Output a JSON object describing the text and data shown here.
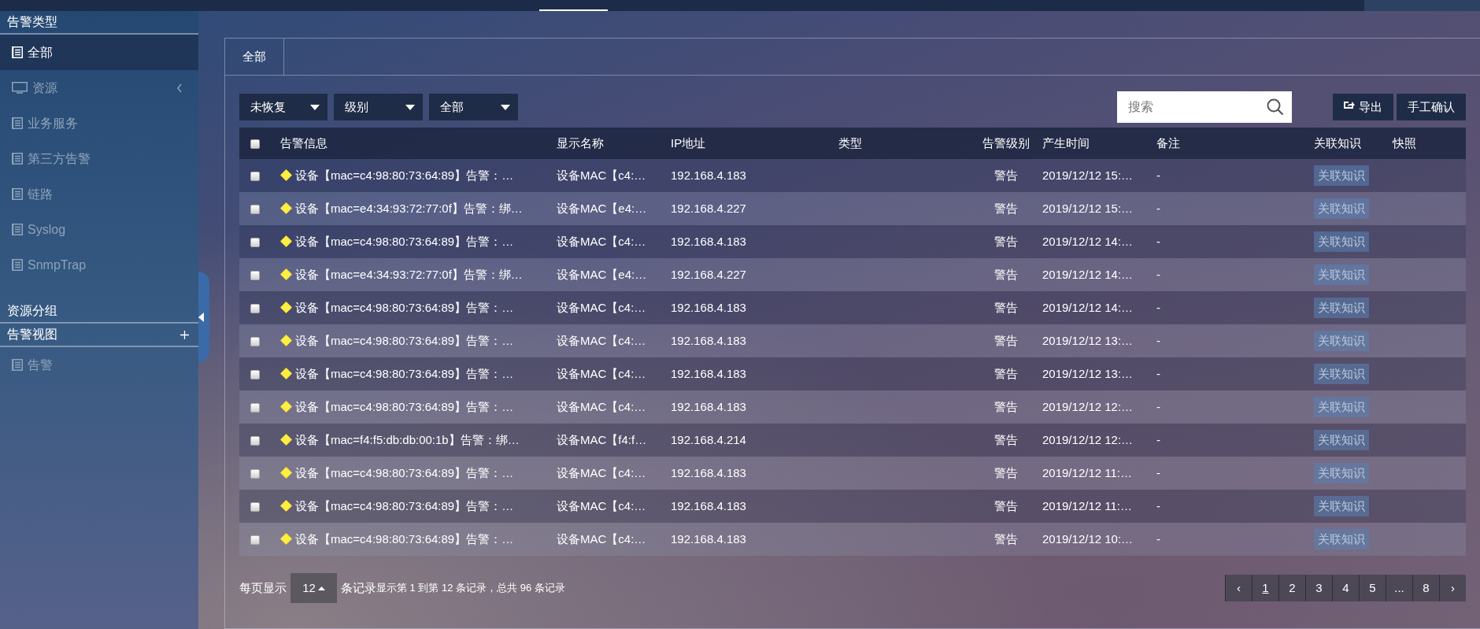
{
  "sidebar": {
    "sections": [
      {
        "title": "告警类型",
        "items": [
          {
            "label": "全部",
            "kind": "list",
            "selected": true
          },
          {
            "label": "资源",
            "kind": "monitor",
            "selected": false,
            "has_submenu": true
          },
          {
            "label": "业务服务",
            "kind": "list",
            "selected": false
          },
          {
            "label": "第三方告警",
            "kind": "list",
            "selected": false
          },
          {
            "label": "链路",
            "kind": "list",
            "selected": false
          },
          {
            "label": "Syslog",
            "kind": "list",
            "selected": false
          },
          {
            "label": "SnmpTrap",
            "kind": "list",
            "selected": false
          }
        ]
      },
      {
        "title": "资源分组"
      },
      {
        "title": "告警视图",
        "add_button": true,
        "items": [
          {
            "label": "告警",
            "kind": "list",
            "selected": false
          }
        ]
      }
    ]
  },
  "tabs": [
    {
      "label": "全部",
      "selected": true
    }
  ],
  "filters": [
    {
      "value": "未恢复"
    },
    {
      "value": "级别"
    },
    {
      "value": "全部"
    }
  ],
  "search": {
    "placeholder": "搜索"
  },
  "buttons": [
    {
      "label": "导出"
    },
    {
      "label": "手工确认"
    }
  ],
  "table": {
    "select_all": {
      "checked": false
    },
    "columns": [
      "告警信息",
      "显示名称",
      "IP地址",
      "类型",
      "告警级别",
      "产生时间",
      "备注",
      "关联知识",
      "快照"
    ],
    "rows": [
      {
        "checked": false,
        "info": "设备【mac=c4:98:80:73:64:89】告警：…",
        "name": "设备MAC【c4:…",
        "ip": "192.168.4.183",
        "level": "警告",
        "time": "2019/12/12 15:…",
        "note": "-",
        "knowledge": "关联知识"
      },
      {
        "checked": false,
        "info": "设备【mac=e4:34:93:72:77:0f】告警：绑…",
        "name": "设备MAC【e4:…",
        "ip": "192.168.4.227",
        "level": "警告",
        "time": "2019/12/12 15:…",
        "note": "-",
        "knowledge": "关联知识"
      },
      {
        "checked": false,
        "info": "设备【mac=c4:98:80:73:64:89】告警：…",
        "name": "设备MAC【c4:…",
        "ip": "192.168.4.183",
        "level": "警告",
        "time": "2019/12/12 14:…",
        "note": "-",
        "knowledge": "关联知识"
      },
      {
        "checked": false,
        "info": "设备【mac=e4:34:93:72:77:0f】告警：绑…",
        "name": "设备MAC【e4:…",
        "ip": "192.168.4.227",
        "level": "警告",
        "time": "2019/12/12 14:…",
        "note": "-",
        "knowledge": "关联知识"
      },
      {
        "checked": false,
        "info": "设备【mac=c4:98:80:73:64:89】告警：…",
        "name": "设备MAC【c4:…",
        "ip": "192.168.4.183",
        "level": "警告",
        "time": "2019/12/12 14:…",
        "note": "-",
        "knowledge": "关联知识"
      },
      {
        "checked": false,
        "info": "设备【mac=c4:98:80:73:64:89】告警：…",
        "name": "设备MAC【c4:…",
        "ip": "192.168.4.183",
        "level": "警告",
        "time": "2019/12/12 13:…",
        "note": "-",
        "knowledge": "关联知识"
      },
      {
        "checked": false,
        "info": "设备【mac=c4:98:80:73:64:89】告警：…",
        "name": "设备MAC【c4:…",
        "ip": "192.168.4.183",
        "level": "警告",
        "time": "2019/12/12 13:…",
        "note": "-",
        "knowledge": "关联知识"
      },
      {
        "checked": false,
        "info": "设备【mac=c4:98:80:73:64:89】告警：…",
        "name": "设备MAC【c4:…",
        "ip": "192.168.4.183",
        "level": "警告",
        "time": "2019/12/12 12:…",
        "note": "-",
        "knowledge": "关联知识"
      },
      {
        "checked": false,
        "info": "设备【mac=f4:f5:db:db:00:1b】告警：绑…",
        "name": "设备MAC【f4:f…",
        "ip": "192.168.4.214",
        "level": "警告",
        "time": "2019/12/12 12:…",
        "note": "-",
        "knowledge": "关联知识"
      },
      {
        "checked": false,
        "info": "设备【mac=c4:98:80:73:64:89】告警：…",
        "name": "设备MAC【c4:…",
        "ip": "192.168.4.183",
        "level": "警告",
        "time": "2019/12/12 11:…",
        "note": "-",
        "knowledge": "关联知识"
      },
      {
        "checked": false,
        "info": "设备【mac=c4:98:80:73:64:89】告警：…",
        "name": "设备MAC【c4:…",
        "ip": "192.168.4.183",
        "level": "警告",
        "time": "2019/12/12 11:…",
        "note": "-",
        "knowledge": "关联知识"
      },
      {
        "checked": false,
        "info": "设备【mac=c4:98:80:73:64:89】告警：…",
        "name": "设备MAC【c4:…",
        "ip": "192.168.4.183",
        "level": "警告",
        "time": "2019/12/12 10:…",
        "note": "-",
        "knowledge": "关联知识"
      }
    ]
  },
  "pagination": {
    "per_page_label": "每页显示",
    "page_size": "12",
    "records_label": "条记录",
    "summary": "显示第 1 到第 12 条记录，总共 96 条记录",
    "pages": [
      {
        "label": "‹",
        "selected": false
      },
      {
        "label": "1",
        "selected": true
      },
      {
        "label": "2",
        "selected": false
      },
      {
        "label": "3",
        "selected": false
      },
      {
        "label": "4",
        "selected": false
      },
      {
        "label": "5",
        "selected": false
      },
      {
        "label": "...",
        "selected": false
      },
      {
        "label": "8",
        "selected": false
      },
      {
        "label": "›",
        "selected": false
      }
    ]
  }
}
